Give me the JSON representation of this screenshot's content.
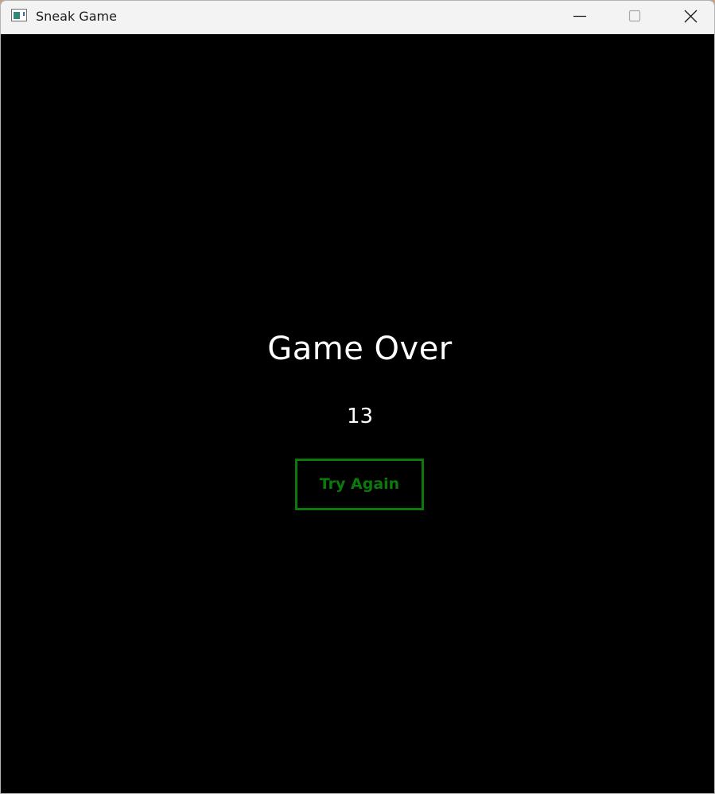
{
  "window": {
    "title": "Sneak Game",
    "app_icon": "window-app-icon",
    "controls": {
      "minimize_icon": "minimize-icon",
      "maximize_icon": "maximize-icon",
      "close_icon": "close-icon"
    }
  },
  "game": {
    "status_text": "Game Over",
    "score": "13",
    "try_again_label": "Try Again"
  },
  "colors": {
    "background": "#000000",
    "text": "#ffffff",
    "button_accent": "#0a7a0a",
    "titlebar": "#f3f3f3"
  }
}
